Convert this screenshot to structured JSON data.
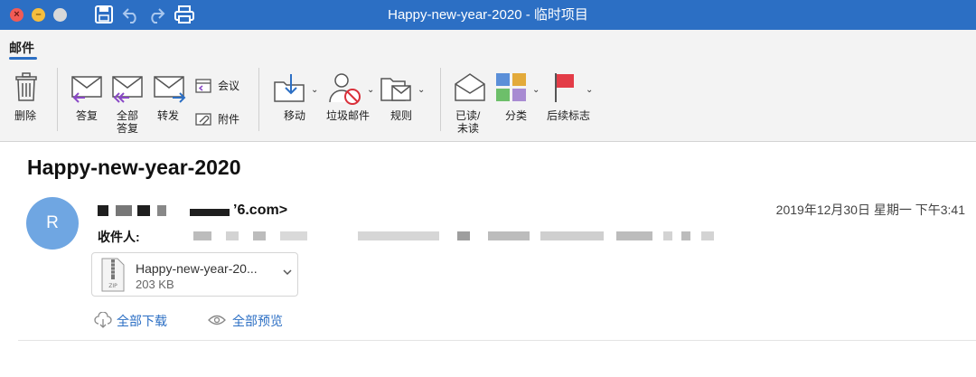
{
  "window": {
    "title": "Happy-new-year-2020 - 临时项目",
    "traffic_lights": [
      "close",
      "minimize",
      "zoom"
    ],
    "title_icons": [
      "save-icon",
      "undo-icon",
      "redo-icon",
      "print-icon"
    ]
  },
  "ribbon": {
    "active_tab": "邮件",
    "buttons": {
      "delete": "删除",
      "reply": "答复",
      "reply_all_1": "全部",
      "reply_all_2": "答复",
      "forward": "转发",
      "meeting": "会议",
      "attachment": "附件",
      "move": "移动",
      "junk": "垃圾邮件",
      "rules": "规则",
      "read_unread_1": "已读/",
      "read_unread_2": "未读",
      "categorize": "分类",
      "follow_up": "后续标志"
    }
  },
  "message": {
    "subject": "Happy-new-year-2020",
    "avatar_initial": "R",
    "sender_email_suffix": "’6.com>",
    "date": "2019年12月30日 星期一 下午3:41",
    "to_label": "收件人:",
    "attachment": {
      "name": "Happy-new-year-20...",
      "size": "203 KB",
      "type_label": "ZIP"
    },
    "actions": {
      "download_all": "全部下载",
      "preview_all": "全部预览"
    }
  },
  "colors": {
    "titlebar": "#2c6fc4",
    "accent": "#2c6fc4",
    "avatar": "#6fa6e2",
    "ribbon_bg": "#f3f3f3"
  }
}
